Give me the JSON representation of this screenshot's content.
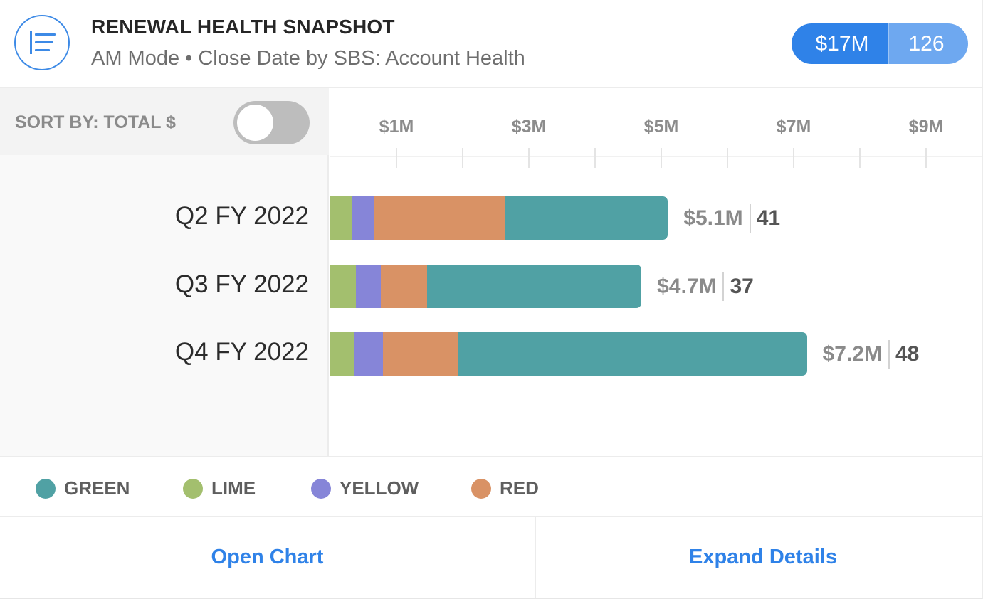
{
  "header": {
    "icon": "list-lines-icon",
    "title": "RENEWAL HEALTH SNAPSHOT",
    "subtitle": "AM Mode • Close Date by SBS: Account Health",
    "total_amount": "$17M",
    "total_count": "126"
  },
  "controls": {
    "sort_label": "SORT BY: TOTAL $",
    "sort_toggle_on": false
  },
  "colors": {
    "accent": "#2f82e8",
    "accent_light": "#6ea8f0",
    "green": "#50a1a4",
    "lime": "#a3bf6e",
    "yellow": "#8685d8",
    "red": "#d99265"
  },
  "chart_data": {
    "type": "bar",
    "orientation": "horizontal",
    "stacked": true,
    "title": "RENEWAL HEALTH SNAPSHOT",
    "xlabel": "",
    "ylabel": "",
    "xlim": [
      0,
      9.8
    ],
    "x_unit": "$M",
    "x_ticks": [
      1,
      2,
      3,
      4,
      5,
      6,
      7,
      8,
      9
    ],
    "x_tick_labels": [
      {
        "value": 1,
        "label": "$1M"
      },
      {
        "value": 3,
        "label": "$3M"
      },
      {
        "value": 5,
        "label": "$5M"
      },
      {
        "value": 7,
        "label": "$7M"
      },
      {
        "value": 9,
        "label": "$9M"
      }
    ],
    "grid": false,
    "legend_position": "bottom-left",
    "categories": [
      "Q2 FY 2022",
      "Q3 FY 2022",
      "Q4 FY 2022"
    ],
    "series": [
      {
        "name": "LIME",
        "color": "#a3bf6e",
        "values": [
          0.33,
          0.39,
          0.37
        ]
      },
      {
        "name": "YELLOW",
        "color": "#8685d8",
        "values": [
          0.33,
          0.37,
          0.43
        ]
      },
      {
        "name": "RED",
        "color": "#d99265",
        "values": [
          1.98,
          0.7,
          1.14
        ]
      },
      {
        "name": "GREEN",
        "color": "#50a1a4",
        "values": [
          2.46,
          3.24,
          5.26
        ]
      }
    ],
    "totals": [
      {
        "amount": "$5.1M",
        "count": "41",
        "value": 5.1
      },
      {
        "amount": "$4.7M",
        "count": "37",
        "value": 4.7
      },
      {
        "amount": "$7.2M",
        "count": "48",
        "value": 7.2
      }
    ],
    "legend": [
      {
        "name": "GREEN",
        "color": "#50a1a4"
      },
      {
        "name": "LIME",
        "color": "#a3bf6e"
      },
      {
        "name": "YELLOW",
        "color": "#8685d8"
      },
      {
        "name": "RED",
        "color": "#d99265"
      }
    ]
  },
  "footer": {
    "open_chart": "Open Chart",
    "expand_details": "Expand Details"
  }
}
